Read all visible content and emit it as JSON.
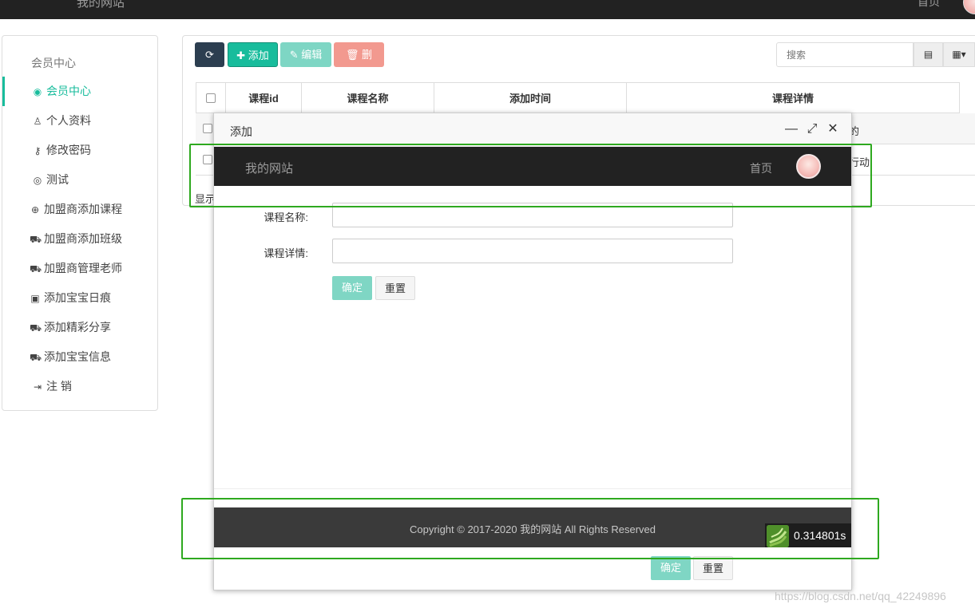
{
  "topnav": {
    "brand": "我的网站",
    "home": "首页"
  },
  "sidebar": {
    "header": "会员中心",
    "items": [
      {
        "icon": "user-circle-icon",
        "glyph": "◉",
        "label": "会员中心",
        "active": true
      },
      {
        "icon": "user-icon",
        "glyph": "♙",
        "label": "个人资料"
      },
      {
        "icon": "key-icon",
        "glyph": "⚷",
        "label": "修改密码"
      },
      {
        "icon": "compass-icon",
        "glyph": "◎",
        "label": "测试"
      },
      {
        "icon": "life-ring-icon",
        "glyph": "⊕",
        "label": "加盟商添加课程"
      },
      {
        "icon": "taxi-icon",
        "glyph": "⛟",
        "label": "加盟商添加班级"
      },
      {
        "icon": "taxi-icon",
        "glyph": "⛟",
        "label": "加盟商管理老师"
      },
      {
        "icon": "subway-icon",
        "glyph": "▣",
        "label": "添加宝宝日痕"
      },
      {
        "icon": "taxi-icon",
        "glyph": "⛟",
        "label": "添加精彩分享"
      },
      {
        "icon": "taxi-icon",
        "glyph": "⛟",
        "label": "添加宝宝信息"
      },
      {
        "icon": "sign-out-icon",
        "glyph": "⇥",
        "label": "注 销"
      }
    ]
  },
  "toolbar": {
    "refresh_glyph": "⟳",
    "add": "✚ 添加",
    "edit": "✎ 编辑",
    "delete": "🗑 删除",
    "search_placeholder": "搜索"
  },
  "table": {
    "columns": [
      "课程id",
      "课程名称",
      "添加时间",
      "课程详情"
    ],
    "row_trails": [
      "的",
      "行动"
    ],
    "showing": "显示"
  },
  "dialog": {
    "title": "添加",
    "inner_brand": "我的网站",
    "inner_home": "首页",
    "fields": [
      {
        "label": "课程名称:",
        "value": ""
      },
      {
        "label": "课程详情:",
        "value": ""
      }
    ],
    "ok": "确定",
    "reset": "重置",
    "footer_copy": "Copyright © 2017-2020 我的网站 All Rights Reserved",
    "timer": "0.314801s",
    "bottom_ok": "确定",
    "bottom_reset": "重置"
  },
  "watermark": "https://blog.csdn.net/qq_42249896",
  "colors": {
    "accent": "#18bc9c",
    "dark": "#222222",
    "danger": "#f2998f",
    "highlight": "#2ea91f"
  }
}
